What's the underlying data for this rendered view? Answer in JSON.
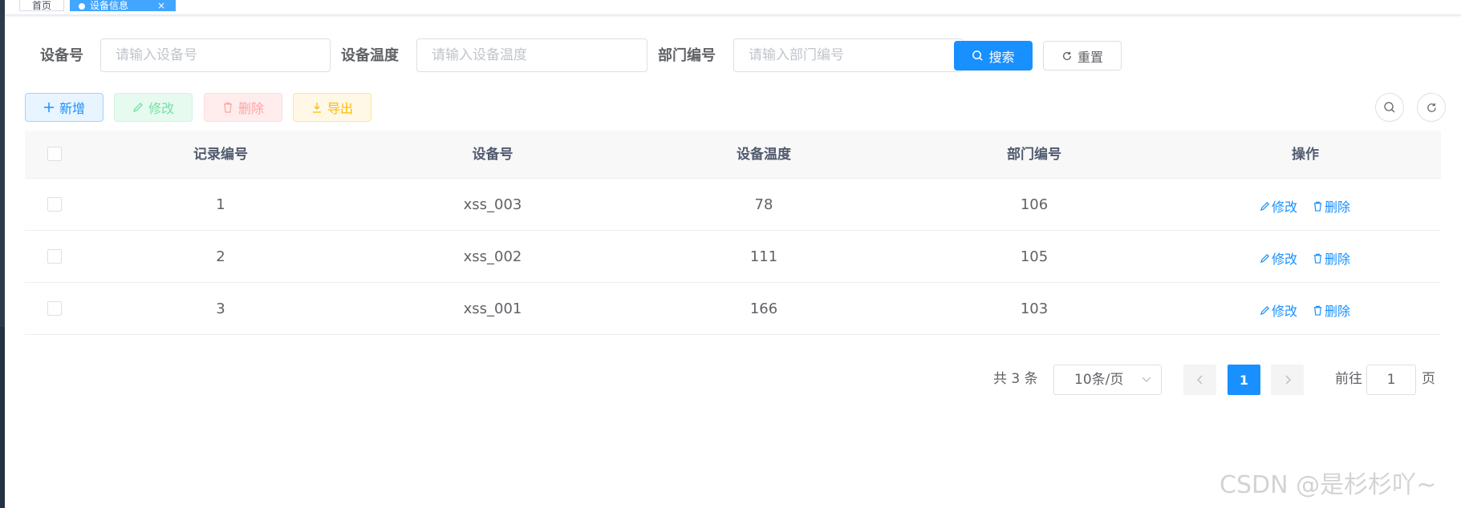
{
  "tags": {
    "home": "首页",
    "active": "设备信息",
    "close": "×"
  },
  "search": {
    "device_no_label": "设备号",
    "device_no_placeholder": "请输入设备号",
    "temp_label": "设备温度",
    "temp_placeholder": "请输入设备温度",
    "dept_label": "部门编号",
    "dept_placeholder": "请输入部门编号",
    "search_btn": "搜索",
    "reset_btn": "重置"
  },
  "toolbar": {
    "add": "新增",
    "edit": "修改",
    "delete": "删除",
    "export": "导出"
  },
  "table": {
    "columns": [
      "记录编号",
      "设备号",
      "设备温度",
      "部门编号",
      "操作"
    ],
    "rows": [
      {
        "id": "1",
        "device": "xss_003",
        "temp": "78",
        "dept": "106"
      },
      {
        "id": "2",
        "device": "xss_002",
        "temp": "111",
        "dept": "105"
      },
      {
        "id": "3",
        "device": "xss_001",
        "temp": "166",
        "dept": "103"
      }
    ],
    "row_edit": "修改",
    "row_delete": "删除"
  },
  "pagination": {
    "total": "共 3 条",
    "page_size": "10条/页",
    "current": "1",
    "goto_prefix": "前往",
    "goto_value": "1",
    "goto_suffix": "页"
  },
  "watermark": "CSDN @是杉杉吖~",
  "colors": {
    "primary": "#1890ff",
    "tag_active": "#42a6ff",
    "success": "#71e2a3",
    "danger": "#ffa4a4",
    "warning": "#ffba00"
  }
}
